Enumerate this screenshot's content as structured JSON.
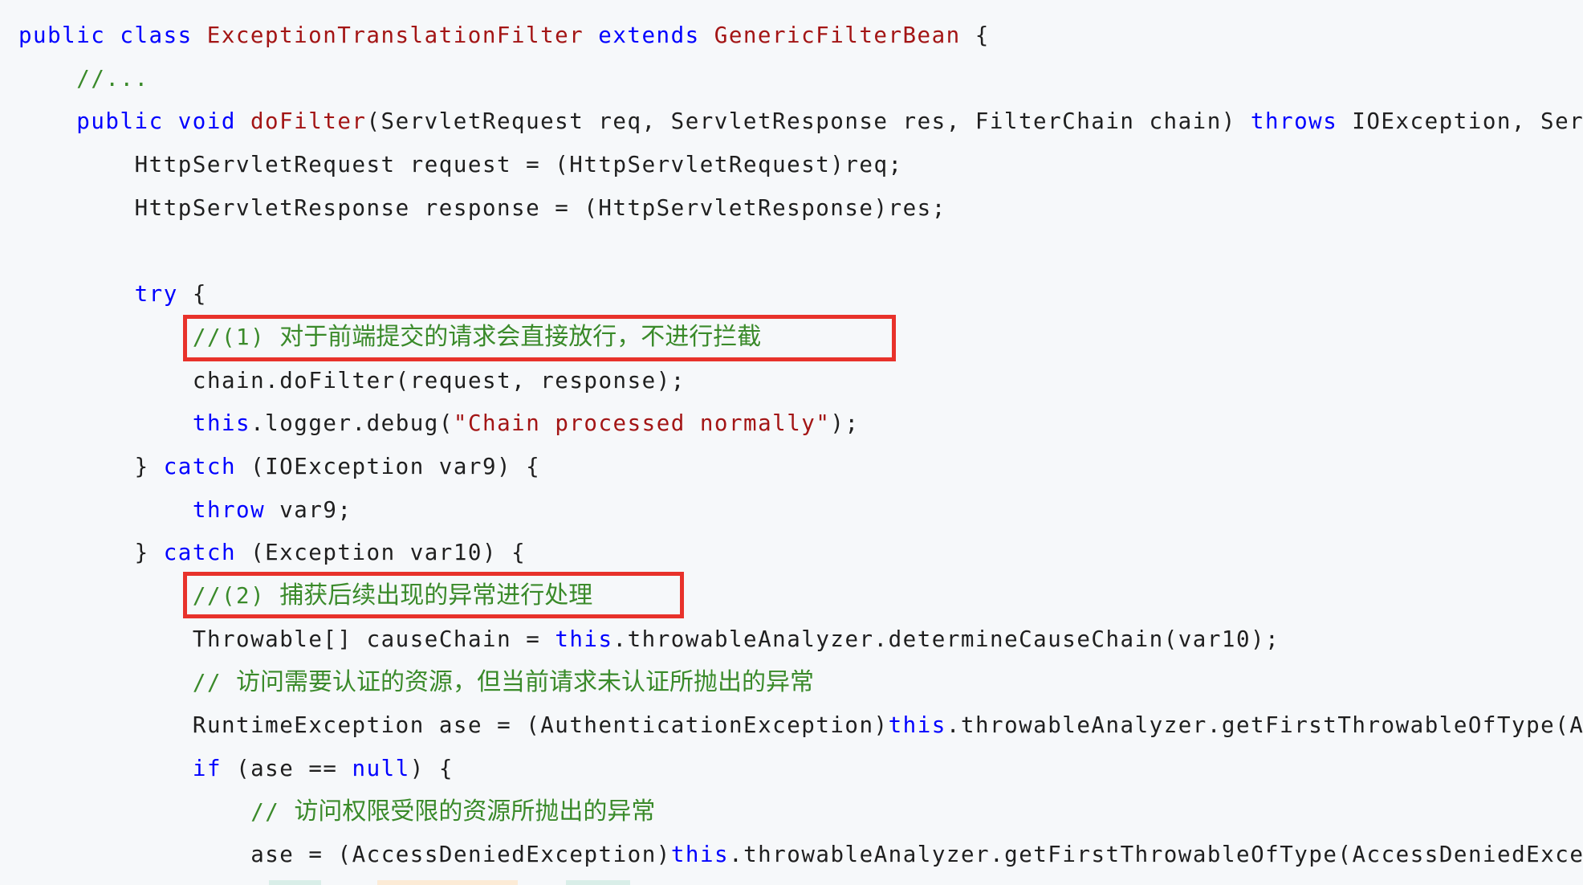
{
  "code": {
    "lines": [
      {
        "indent": 0,
        "tokens": [
          {
            "t": "public",
            "c": "kw"
          },
          {
            "t": " ",
            "c": "pl"
          },
          {
            "t": "class",
            "c": "kw"
          },
          {
            "t": " ",
            "c": "pl"
          },
          {
            "t": "ExceptionTranslationFilter",
            "c": "cls"
          },
          {
            "t": " ",
            "c": "pl"
          },
          {
            "t": "extends",
            "c": "kw"
          },
          {
            "t": " ",
            "c": "pl"
          },
          {
            "t": "GenericFilterBean",
            "c": "cls"
          },
          {
            "t": " {",
            "c": "pl"
          }
        ]
      },
      {
        "indent": 1,
        "tokens": [
          {
            "t": "//...",
            "c": "cm"
          }
        ]
      },
      {
        "indent": 1,
        "tokens": [
          {
            "t": "public",
            "c": "kw"
          },
          {
            "t": " ",
            "c": "pl"
          },
          {
            "t": "void",
            "c": "kw"
          },
          {
            "t": " ",
            "c": "pl"
          },
          {
            "t": "doFilter",
            "c": "cls"
          },
          {
            "t": "(ServletRequest req, ServletResponse res, FilterChain chain) ",
            "c": "pl"
          },
          {
            "t": "throws",
            "c": "kw"
          },
          {
            "t": " IOException, ServletException {",
            "c": "pl"
          }
        ]
      },
      {
        "indent": 2,
        "tokens": [
          {
            "t": "HttpServletRequest request = (HttpServletRequest)req;",
            "c": "pl"
          }
        ]
      },
      {
        "indent": 2,
        "tokens": [
          {
            "t": "HttpServletResponse response = (HttpServletResponse)res;",
            "c": "pl"
          }
        ]
      },
      {
        "indent": 0,
        "tokens": []
      },
      {
        "indent": 2,
        "tokens": [
          {
            "t": "try",
            "c": "kw"
          },
          {
            "t": " {",
            "c": "pl"
          }
        ]
      },
      {
        "indent": 3,
        "tokens": [
          {
            "t": "//(1) ",
            "c": "cm"
          },
          {
            "t": "对于前端提交的请求会直接放行，不进行拦截",
            "c": "cm cjk"
          }
        ]
      },
      {
        "indent": 3,
        "tokens": [
          {
            "t": "chain.doFilter(request, response);",
            "c": "pl"
          }
        ]
      },
      {
        "indent": 3,
        "tokens": [
          {
            "t": "this",
            "c": "kw"
          },
          {
            "t": ".logger.debug(",
            "c": "pl"
          },
          {
            "t": "\"Chain processed normally\"",
            "c": "str"
          },
          {
            "t": ");",
            "c": "pl"
          }
        ]
      },
      {
        "indent": 2,
        "tokens": [
          {
            "t": "} ",
            "c": "pl"
          },
          {
            "t": "catch",
            "c": "kw"
          },
          {
            "t": " (IOException var9) {",
            "c": "pl"
          }
        ]
      },
      {
        "indent": 3,
        "tokens": [
          {
            "t": "throw",
            "c": "kw"
          },
          {
            "t": " var9;",
            "c": "pl"
          }
        ]
      },
      {
        "indent": 2,
        "tokens": [
          {
            "t": "} ",
            "c": "pl"
          },
          {
            "t": "catch",
            "c": "kw"
          },
          {
            "t": " (Exception var10) {",
            "c": "pl"
          }
        ]
      },
      {
        "indent": 3,
        "tokens": [
          {
            "t": "//(2) ",
            "c": "cm"
          },
          {
            "t": "捕获后续出现的异常进行处理",
            "c": "cm cjk"
          }
        ]
      },
      {
        "indent": 3,
        "tokens": [
          {
            "t": "Throwable[] causeChain = ",
            "c": "pl"
          },
          {
            "t": "this",
            "c": "kw"
          },
          {
            "t": ".throwableAnalyzer.determineCauseChain(var10);",
            "c": "pl"
          }
        ]
      },
      {
        "indent": 3,
        "tokens": [
          {
            "t": "// ",
            "c": "cm"
          },
          {
            "t": "访问需要认证的资源，但当前请求未认证所抛出的异常",
            "c": "cm cjk"
          }
        ]
      },
      {
        "indent": 3,
        "tokens": [
          {
            "t": "RuntimeException ase = (AuthenticationException)",
            "c": "pl"
          },
          {
            "t": "this",
            "c": "kw"
          },
          {
            "t": ".throwableAnalyzer.getFirstThrowableOfType(AuthenticationException.class, causeChain);",
            "c": "pl"
          }
        ]
      },
      {
        "indent": 3,
        "tokens": [
          {
            "t": "if",
            "c": "kw"
          },
          {
            "t": " (ase == ",
            "c": "pl"
          },
          {
            "t": "null",
            "c": "kw"
          },
          {
            "t": ") {",
            "c": "pl"
          }
        ]
      },
      {
        "indent": 4,
        "tokens": [
          {
            "t": "// ",
            "c": "cm"
          },
          {
            "t": "访问权限受限的资源所抛出的异常",
            "c": "cm cjk"
          }
        ]
      },
      {
        "indent": 4,
        "tokens": [
          {
            "t": "ase = (AccessDeniedException)",
            "c": "pl"
          },
          {
            "t": "this",
            "c": "kw"
          },
          {
            "t": ".throwableAnalyzer.getFirstThrowableOfType(AccessDeniedException.class, causeChain);",
            "c": "pl"
          }
        ]
      }
    ]
  },
  "annotations": [
    {
      "label": "highlight-box-1",
      "line": 7
    },
    {
      "label": "highlight-box-2",
      "line": 13
    }
  ],
  "colors": {
    "background": "#f6f8fa",
    "keyword": "#0000ff",
    "type_name": "#a31515",
    "string": "#a31515",
    "comment": "#3a8a2a",
    "plain": "#1f1f1f",
    "highlight_border": "#e8322b"
  }
}
